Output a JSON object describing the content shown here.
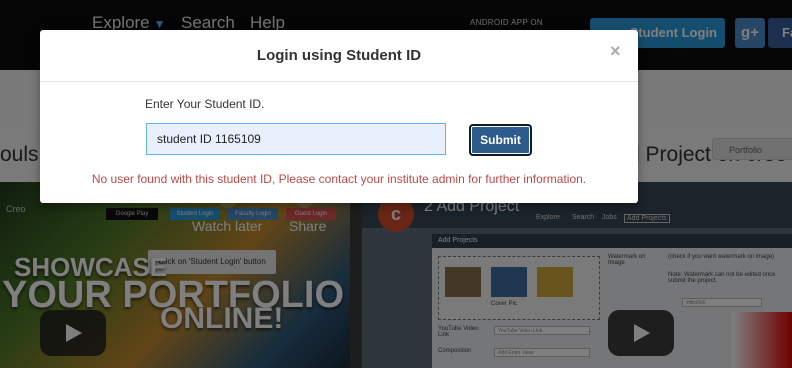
{
  "nav": {
    "explore": "Explore",
    "search": "Search",
    "help": "Help",
    "app_badge": "ANDROID APP ON",
    "student_login": "Student Login",
    "gplus": "g+",
    "fb": "Fa"
  },
  "heading": {
    "left": "ouls:",
    "right": "d Project on creo",
    "pill": "Portfolio"
  },
  "video_left": {
    "showcase": "SHOWCASE",
    "portfolio": "YOUR PORTFOLIO",
    "online": "ONLINE!",
    "tip": "Click on 'Student Login' button",
    "google_play": "Google Play",
    "student_login": "Student Login",
    "faculty_login": "Faculty Login",
    "guest_login": "Guest Login",
    "watch_later": "Watch later",
    "share": "Share",
    "brand": "Creo"
  },
  "video_right": {
    "avatar_letter": "c",
    "title": "2 Add Project",
    "nav": [
      "Explore",
      "Search",
      "Jobs",
      "Add Projects"
    ],
    "panel_title": "Add Projects",
    "labels": {
      "watermark": "Watermark on Image",
      "checkbox": "(check if you want watermark on image)",
      "note": "Note: Watermark can not be edited once submit the project.",
      "youtube": "YouTube Video Link",
      "composition": "Composition",
      "cover": "Cover Pic"
    },
    "placeholders": {
      "youtube": "YouTube Video Link",
      "composition": "Add Erato Value",
      "color": "#dba0cE"
    }
  },
  "modal": {
    "title": "Login using Student ID",
    "close": "×",
    "field_label": "Enter Your Student ID.",
    "input_value": "student ID 1165109",
    "submit": "Submit",
    "error": "No user found with this student ID, Please contact your institute admin for further information."
  },
  "colors": {
    "error": "#b94a48",
    "submit_bg": "#2d5b8c",
    "input_border": "#66afe9",
    "student_btn": "#2b9bdc"
  }
}
